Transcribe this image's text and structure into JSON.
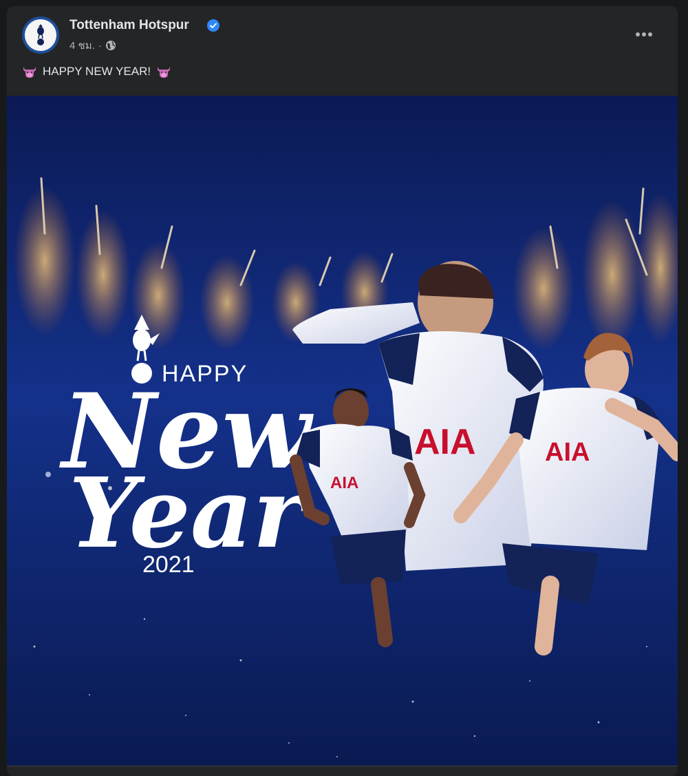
{
  "post": {
    "page_name": "Tottenham Hotspur",
    "verified": true,
    "timestamp": "4 ชม.",
    "separator": "·",
    "audience_icon": "globe-icon",
    "more_icon": "more-horizontal-icon",
    "caption": "HAPPY NEW YEAR!",
    "caption_emoji": "ox-emoji"
  },
  "image": {
    "happy": "HAPPY",
    "new": "New",
    "year": "Year",
    "year_number": "2021",
    "jersey_sponsor": "AIA"
  },
  "colors": {
    "background": "#18191a",
    "card": "#242526",
    "text_primary": "#e4e6eb",
    "text_secondary": "#b0b3b8",
    "verified_blue": "#2d88ff",
    "navy": "#132257"
  }
}
